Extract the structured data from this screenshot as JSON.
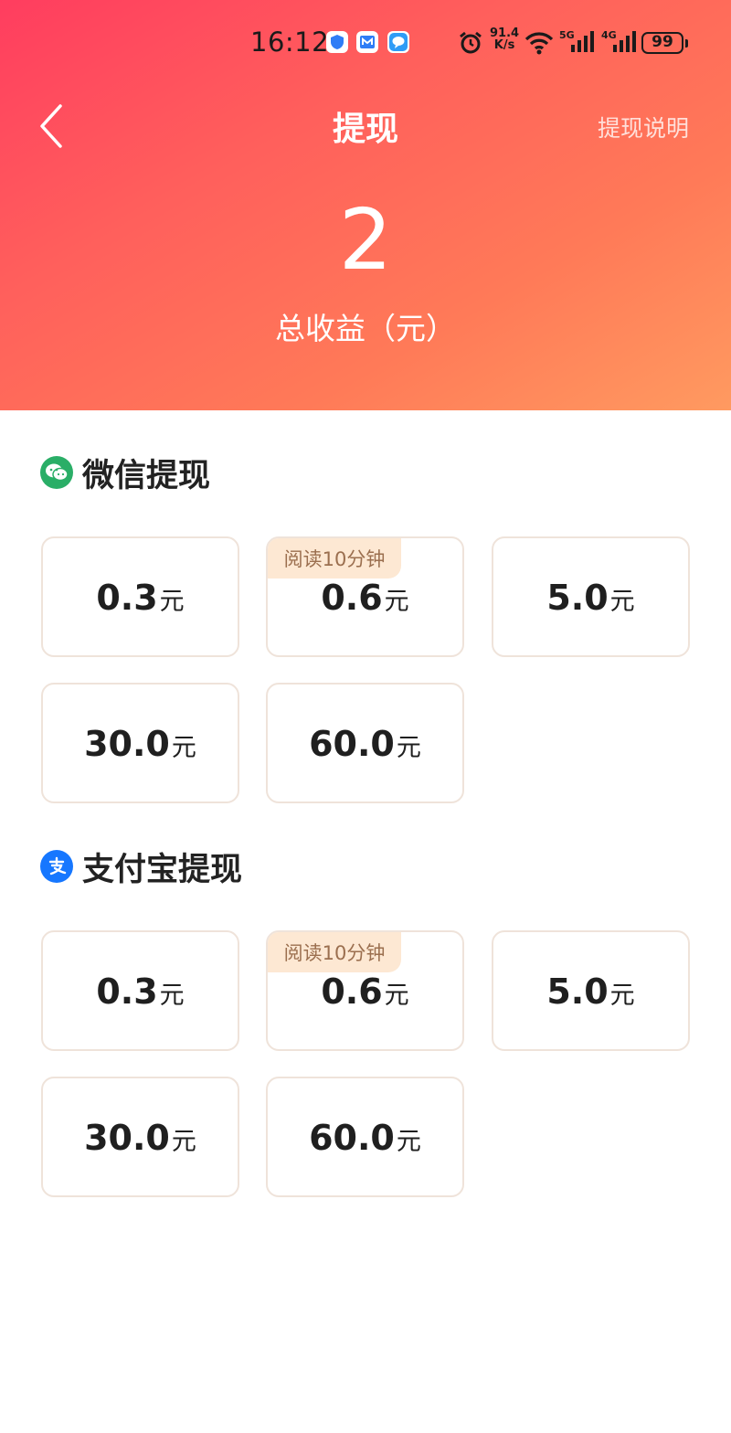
{
  "status_bar": {
    "time": "16:12",
    "net_speed_value": "91.4",
    "net_speed_unit": "K/s",
    "signal_1_label": "5G",
    "signal_2_label": "4G",
    "battery": "99",
    "icons": [
      "shield-app-icon",
      "mail-app-icon",
      "message-app-icon",
      "alarm-icon",
      "wifi-icon",
      "cell-signal-icon",
      "battery-icon"
    ]
  },
  "nav": {
    "title": "提现",
    "help_link": "提现说明"
  },
  "balance": {
    "value": "2",
    "label": "总收益（元）"
  },
  "wechat": {
    "title": "微信提现",
    "color": "#2aae67",
    "options": [
      {
        "amount": "0.3",
        "unit": "元",
        "badge": ""
      },
      {
        "amount": "0.6",
        "unit": "元",
        "badge": "阅读10分钟"
      },
      {
        "amount": "5.0",
        "unit": "元",
        "badge": ""
      },
      {
        "amount": "30.0",
        "unit": "元",
        "badge": ""
      },
      {
        "amount": "60.0",
        "unit": "元",
        "badge": ""
      }
    ]
  },
  "alipay": {
    "title": "支付宝提现",
    "color": "#1677ff",
    "options": [
      {
        "amount": "0.3",
        "unit": "元",
        "badge": ""
      },
      {
        "amount": "0.6",
        "unit": "元",
        "badge": "阅读10分钟"
      },
      {
        "amount": "5.0",
        "unit": "元",
        "badge": ""
      },
      {
        "amount": "30.0",
        "unit": "元",
        "badge": ""
      },
      {
        "amount": "60.0",
        "unit": "元",
        "badge": ""
      }
    ]
  },
  "colors": {
    "header_gradient_start": "#ff3d5f",
    "header_gradient_end": "#ff9a60",
    "badge_bg": "#fde8d3",
    "badge_text": "#9b6f4f",
    "card_border": "#efe3da"
  }
}
